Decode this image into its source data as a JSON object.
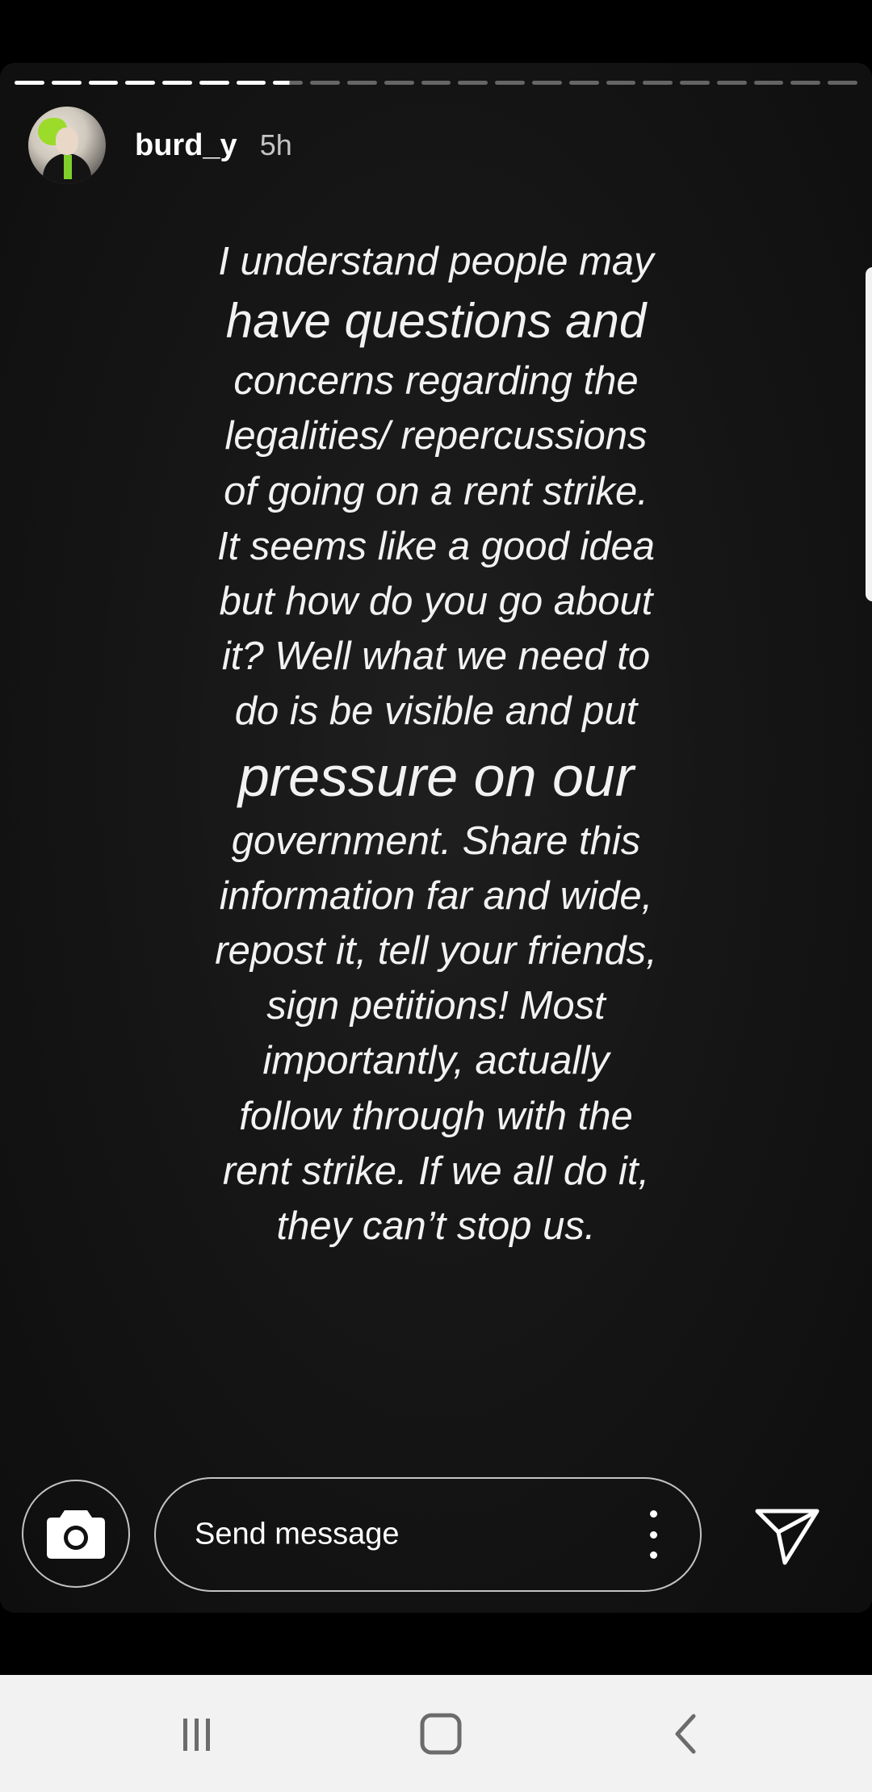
{
  "story": {
    "username": "burd_y",
    "time": "5h",
    "progress": {
      "total_segments": 23,
      "completed": 7,
      "active_index": 7
    },
    "text_lines": [
      {
        "text": "I understand people may",
        "size": "normal"
      },
      {
        "text": "have questions and",
        "size": "big"
      },
      {
        "text": "concerns regarding the",
        "size": "normal"
      },
      {
        "text": "legalities/ repercussions",
        "size": "normal"
      },
      {
        "text": "of going on a rent strike.",
        "size": "normal"
      },
      {
        "text": "It seems like a good idea",
        "size": "normal"
      },
      {
        "text": "but how do you go about",
        "size": "normal"
      },
      {
        "text": "it? Well what we need to",
        "size": "normal"
      },
      {
        "text": "do is be visible and put",
        "size": "normal"
      },
      {
        "text": "pressure on our",
        "size": "huge"
      },
      {
        "text": "government. Share this",
        "size": "normal"
      },
      {
        "text": "information far and wide,",
        "size": "normal"
      },
      {
        "text": "repost it, tell your friends,",
        "size": "normal"
      },
      {
        "text": "sign petitions! Most",
        "size": "normal"
      },
      {
        "text": "importantly, actually",
        "size": "normal"
      },
      {
        "text": "follow through with the",
        "size": "normal"
      },
      {
        "text": "rent strike. If we all do it,",
        "size": "normal"
      },
      {
        "text": "they can’t stop us.",
        "size": "normal"
      }
    ]
  },
  "reply": {
    "placeholder": "Send message",
    "camera_icon": "camera-icon",
    "more_icon": "more-vertical-icon",
    "send_icon": "send-icon"
  },
  "navbar": {
    "recents_icon": "recents-icon",
    "home_icon": "home-icon",
    "back_icon": "back-icon"
  },
  "colors": {
    "background": "#000000",
    "story_bg": "#161616",
    "text": "#f2f2f2",
    "navbar_bg": "#f2f2f2",
    "nav_icon": "#6b6b6b"
  }
}
